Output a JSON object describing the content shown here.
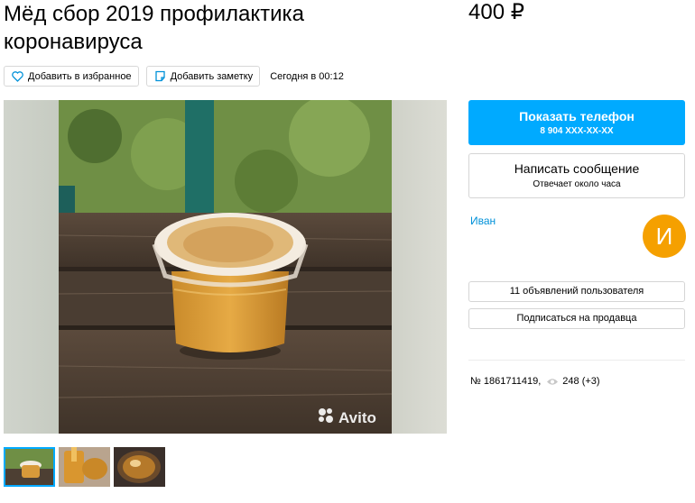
{
  "listing": {
    "title": "Мёд сбор 2019 профилактика коронавируса",
    "price": "400 ₽"
  },
  "actions": {
    "favorite_label": "Добавить в избранное",
    "note_label": "Добавить заметку",
    "date": "Сегодня в 00:12"
  },
  "gallery": {
    "watermark": "Avito",
    "thumbnail_count": 3
  },
  "contact": {
    "show_phone_label": "Показать телефон",
    "phone_masked": "8 904 XXX-XX-XX",
    "message_label": "Написать сообщение",
    "response_time": "Отвечает около часа"
  },
  "seller": {
    "name": "Иван",
    "avatar_letter": "И",
    "listings_label": "11 объявлений пользователя",
    "subscribe_label": "Подписаться на продавца"
  },
  "stats": {
    "ad_number": "№ 1861711419,",
    "views": "248 (+3)"
  },
  "colors": {
    "accent": "#00aaff",
    "avatar": "#f5a000",
    "link": "#0091d9"
  }
}
